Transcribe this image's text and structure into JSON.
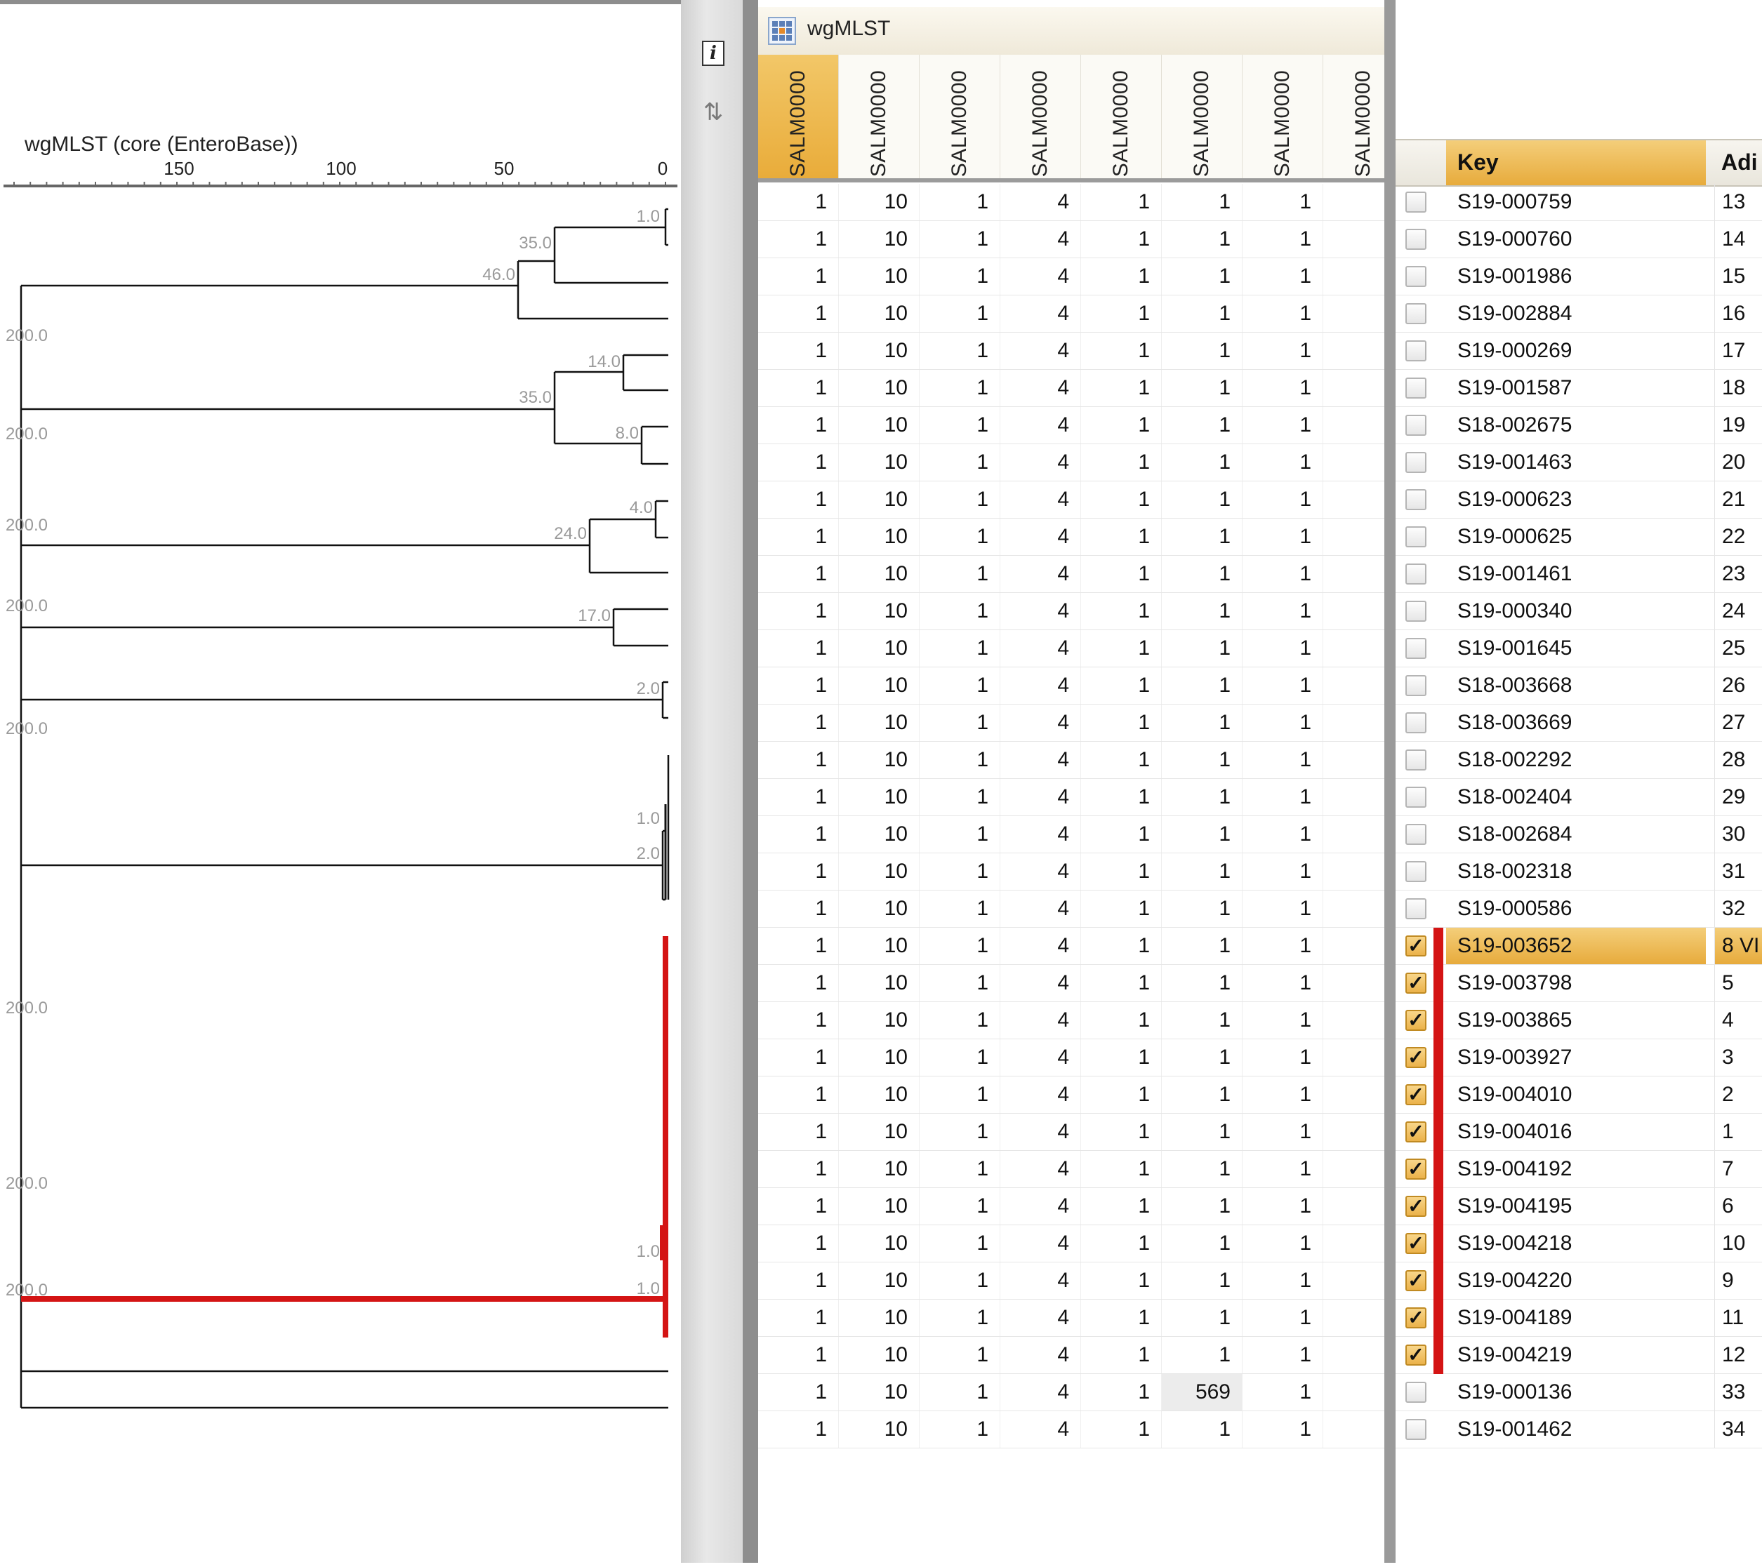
{
  "dendrogram": {
    "title": "wgMLST (core (EnteroBase))",
    "axis_ticks": [
      "150",
      "100",
      "50",
      "0"
    ],
    "node_labels": [
      "1.0",
      "35.0",
      "46.0",
      "200.0",
      "14.0",
      "35.0",
      "8.0",
      "200.0",
      "4.0",
      "24.0",
      "200.0",
      "17.0",
      "200.0",
      "2.0",
      "200.0",
      "1.0",
      "2.0",
      "200.0",
      "200.0",
      "1.0",
      "200.0",
      "1.0"
    ],
    "highlight_color": "#d41414"
  },
  "toolbar": {
    "info_icon_glyph": "i",
    "info_icon": "info-icon",
    "sort_icon": "sort-icon",
    "sort_icon_glyph": "⇅"
  },
  "grid": {
    "title": "wgMLST",
    "icon": "grid-icon",
    "columns": [
      "SALM0000",
      "SALM0000",
      "SALM0000",
      "SALM0000",
      "SALM0000",
      "SALM0000",
      "SALM0000",
      "SALM0000"
    ],
    "rows": [
      [
        "1",
        "10",
        "1",
        "4",
        "1",
        "1",
        "1",
        ""
      ],
      [
        "1",
        "10",
        "1",
        "4",
        "1",
        "1",
        "1",
        ""
      ],
      [
        "1",
        "10",
        "1",
        "4",
        "1",
        "1",
        "1",
        ""
      ],
      [
        "1",
        "10",
        "1",
        "4",
        "1",
        "1",
        "1",
        ""
      ],
      [
        "1",
        "10",
        "1",
        "4",
        "1",
        "1",
        "1",
        ""
      ],
      [
        "1",
        "10",
        "1",
        "4",
        "1",
        "1",
        "1",
        ""
      ],
      [
        "1",
        "10",
        "1",
        "4",
        "1",
        "1",
        "1",
        ""
      ],
      [
        "1",
        "10",
        "1",
        "4",
        "1",
        "1",
        "1",
        ""
      ],
      [
        "1",
        "10",
        "1",
        "4",
        "1",
        "1",
        "1",
        ""
      ],
      [
        "1",
        "10",
        "1",
        "4",
        "1",
        "1",
        "1",
        ""
      ],
      [
        "1",
        "10",
        "1",
        "4",
        "1",
        "1",
        "1",
        ""
      ],
      [
        "1",
        "10",
        "1",
        "4",
        "1",
        "1",
        "1",
        ""
      ],
      [
        "1",
        "10",
        "1",
        "4",
        "1",
        "1",
        "1",
        ""
      ],
      [
        "1",
        "10",
        "1",
        "4",
        "1",
        "1",
        "1",
        ""
      ],
      [
        "1",
        "10",
        "1",
        "4",
        "1",
        "1",
        "1",
        ""
      ],
      [
        "1",
        "10",
        "1",
        "4",
        "1",
        "1",
        "1",
        ""
      ],
      [
        "1",
        "10",
        "1",
        "4",
        "1",
        "1",
        "1",
        ""
      ],
      [
        "1",
        "10",
        "1",
        "4",
        "1",
        "1",
        "1",
        ""
      ],
      [
        "1",
        "10",
        "1",
        "4",
        "1",
        "1",
        "1",
        ""
      ],
      [
        "1",
        "10",
        "1",
        "4",
        "1",
        "1",
        "1",
        ""
      ],
      [
        "1",
        "10",
        "1",
        "4",
        "1",
        "1",
        "1",
        ""
      ],
      [
        "1",
        "10",
        "1",
        "4",
        "1",
        "1",
        "1",
        ""
      ],
      [
        "1",
        "10",
        "1",
        "4",
        "1",
        "1",
        "1",
        ""
      ],
      [
        "1",
        "10",
        "1",
        "4",
        "1",
        "1",
        "1",
        ""
      ],
      [
        "1",
        "10",
        "1",
        "4",
        "1",
        "1",
        "1",
        ""
      ],
      [
        "1",
        "10",
        "1",
        "4",
        "1",
        "1",
        "1",
        ""
      ],
      [
        "1",
        "10",
        "1",
        "4",
        "1",
        "1",
        "1",
        ""
      ],
      [
        "1",
        "10",
        "1",
        "4",
        "1",
        "1",
        "1",
        ""
      ],
      [
        "1",
        "10",
        "1",
        "4",
        "1",
        "1",
        "1",
        ""
      ],
      [
        "1",
        "10",
        "1",
        "4",
        "1",
        "1",
        "1",
        ""
      ],
      [
        "1",
        "10",
        "1",
        "4",
        "1",
        "1",
        "1",
        ""
      ],
      [
        "1",
        "10",
        "1",
        "4",
        "1",
        "1",
        "1",
        ""
      ],
      [
        "1",
        "10",
        "1",
        "4",
        "1",
        "569",
        "1",
        ""
      ],
      [
        "1",
        "10",
        "1",
        "4",
        "1",
        "1",
        "1",
        ""
      ]
    ]
  },
  "keys": {
    "header_key": "Key",
    "header_adi": "Adi",
    "checked_color": "#ebb24a",
    "rows": [
      {
        "key": "S19-000759",
        "adi": "13",
        "checked": false
      },
      {
        "key": "S19-000760",
        "adi": "14",
        "checked": false
      },
      {
        "key": "S19-001986",
        "adi": "15",
        "checked": false
      },
      {
        "key": "S19-002884",
        "adi": "16",
        "checked": false
      },
      {
        "key": "S19-000269",
        "adi": "17",
        "checked": false
      },
      {
        "key": "S19-001587",
        "adi": "18",
        "checked": false
      },
      {
        "key": "S18-002675",
        "adi": "19",
        "checked": false
      },
      {
        "key": "S19-001463",
        "adi": "20",
        "checked": false
      },
      {
        "key": "S19-000623",
        "adi": "21",
        "checked": false
      },
      {
        "key": "S19-000625",
        "adi": "22",
        "checked": false
      },
      {
        "key": "S19-001461",
        "adi": "23",
        "checked": false
      },
      {
        "key": "S19-000340",
        "adi": "24",
        "checked": false
      },
      {
        "key": "S19-001645",
        "adi": "25",
        "checked": false
      },
      {
        "key": "S18-003668",
        "adi": "26",
        "checked": false
      },
      {
        "key": "S18-003669",
        "adi": "27",
        "checked": false
      },
      {
        "key": "S18-002292",
        "adi": "28",
        "checked": false
      },
      {
        "key": "S18-002404",
        "adi": "29",
        "checked": false
      },
      {
        "key": "S18-002684",
        "adi": "30",
        "checked": false
      },
      {
        "key": "S18-002318",
        "adi": "31",
        "checked": false
      },
      {
        "key": "S19-000586",
        "adi": "32",
        "checked": false
      },
      {
        "key": "S19-003652",
        "adi": "8 VI",
        "checked": true,
        "selected": true
      },
      {
        "key": "S19-003798",
        "adi": "5",
        "checked": true
      },
      {
        "key": "S19-003865",
        "adi": "4",
        "checked": true
      },
      {
        "key": "S19-003927",
        "adi": "3",
        "checked": true
      },
      {
        "key": "S19-004010",
        "adi": "2",
        "checked": true
      },
      {
        "key": "S19-004016",
        "adi": "1",
        "checked": true
      },
      {
        "key": "S19-004192",
        "adi": "7",
        "checked": true
      },
      {
        "key": "S19-004195",
        "adi": "6",
        "checked": true
      },
      {
        "key": "S19-004218",
        "adi": "10",
        "checked": true
      },
      {
        "key": "S19-004220",
        "adi": "9",
        "checked": true
      },
      {
        "key": "S19-004189",
        "adi": "11",
        "checked": true
      },
      {
        "key": "S19-004219",
        "adi": "12",
        "checked": true
      },
      {
        "key": "S19-000136",
        "adi": "33",
        "checked": false
      },
      {
        "key": "S19-001462",
        "adi": "34",
        "checked": false
      }
    ]
  }
}
